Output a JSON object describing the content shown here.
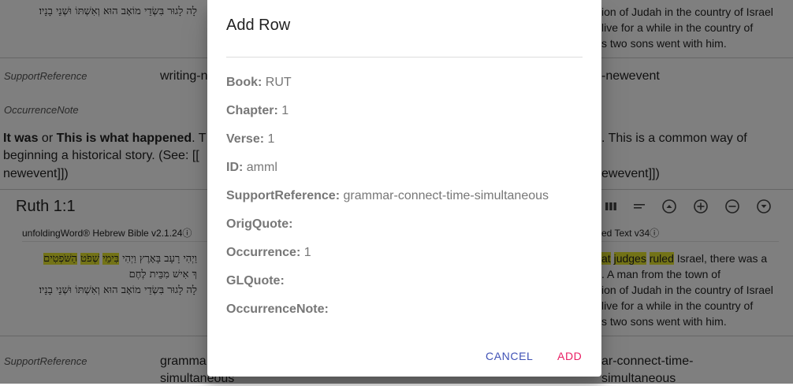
{
  "background": {
    "top_hebrew_line": "לָה לָגוּר בִּשְׂדֵי מוֹאָב הוּא וְאִשְׁתּוֹ וּשְׁנֵי בָנָיו׃",
    "top_english_line1": "ion of Judah in the country of Israel",
    "top_english_line2": "live for a while in the country of",
    "top_english_line3": "s two sons went with him.",
    "row1": {
      "support_reference_label": "SupportReference",
      "support_reference_value_left": "writing-n",
      "support_reference_value_right": "-newevent",
      "occurrence_note_label": "OccurrenceNote",
      "note_bold1": "It was",
      "note_or": " or ",
      "note_bold2": "This is what happened",
      "note_rest1": ". T",
      "note_right1": ". This is a common way of",
      "note_line2": "beginning a historical story. (See: [[",
      "note_line3_left": "newevent]])",
      "note_line3_right": "ewevent]])"
    },
    "reference": "Ruth 1:1",
    "hebrew_bible_label": "unfoldingWord® Hebrew Bible v2.1.24",
    "info_icon_symbol": "ⓘ",
    "literal_text_label": "ed Text v34",
    "toolbar_icons": [
      "columns-icon",
      "align-icon",
      "expand-circle-icon",
      "add-circle-icon",
      "remove-circle-icon",
      "chevron-circle-icon"
    ],
    "hebrew_line1_prefix": "וַיְהִי רָעָב בָּאָרֶץ",
    "hebrew_line1_hl1": "בִּימֵי",
    "hebrew_line1_hl2": "שְׁפֹט",
    "hebrew_line1_hl3": "הַשֹּׁפְטִים",
    "hebrew_line1_rest": "וַיְהִי",
    "hebrew_line2": "ךְ אִישׁ מִבֵּית לֶחֶם",
    "hebrew_line3": "לָה לָגוּר בִּשְׂדֵי מוֹאָב הוּא וְאִשְׁתּוֹ וּשְׁנֵי בָנָיו׃",
    "english_hl1": "at",
    "english_hl2": "judges",
    "english_hl3": "ruled",
    "english_line1_rest": " Israel, there was a",
    "english_line2": ". A man from the town of",
    "english_line3": "ion of Judah in the country of Israel",
    "english_line4": "live for a while in the country of",
    "english_line5": "s two sons went with him.",
    "row2": {
      "support_reference_label": "SupportReference",
      "value_left_line1": "gramma",
      "value_left_line2": "simultaneous",
      "value_right_line1": "ar-connect-time-",
      "value_right_line2": "simultaneous"
    }
  },
  "dialog": {
    "title": "Add Row",
    "fields": [
      {
        "label": "Book:",
        "value": "RUT"
      },
      {
        "label": "Chapter:",
        "value": "1"
      },
      {
        "label": "Verse:",
        "value": "1"
      },
      {
        "label": "ID:",
        "value": "amml"
      },
      {
        "label": "SupportReference:",
        "value": "grammar-connect-time-simultaneous"
      },
      {
        "label": "OrigQuote:",
        "value": ""
      },
      {
        "label": "Occurrence:",
        "value": "1"
      },
      {
        "label": "GLQuote:",
        "value": ""
      },
      {
        "label": "OccurrenceNote:",
        "value": ""
      }
    ],
    "cancel_label": "CANCEL",
    "add_label": "ADD",
    "cancel_color": "#3f51b5",
    "add_color": "#e91e63"
  }
}
